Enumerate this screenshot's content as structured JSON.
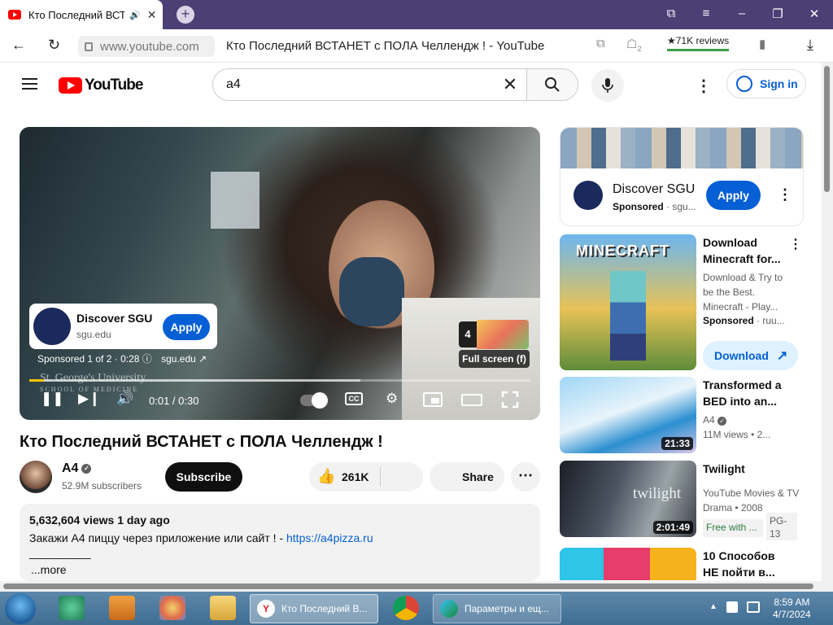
{
  "browser": {
    "tab_title": "Кто Последний ВСТ",
    "new_tab": "+",
    "url": "www.youtube.com",
    "page_title": "Кто Последний ВСТАНЕТ с ПОЛА Челлендж ! - YouTube",
    "reviews": "★71K reviews",
    "tab_badge_count": "2"
  },
  "header": {
    "logo_text": "YouTube",
    "search_query": "a4",
    "sign_in": "Sign in"
  },
  "player": {
    "ad_title": "Discover SGU",
    "ad_domain": "sgu.edu",
    "ad_apply": "Apply",
    "ad_info": "Sponsored 1 of 2 · 0:28",
    "ad_info_domain": "sgu.edu",
    "next_count": "4",
    "full_screen_tip": "Full screen (f)",
    "watermark": "St. George's University",
    "watermark_sub": "SCHOOL OF MEDICINE",
    "time": "0:01 / 0:30",
    "progress_fraction": 0.03,
    "buffered_fraction": 0.66
  },
  "video": {
    "title": "Кто Последний ВСТАНЕТ с ПОЛА Челлендж !",
    "channel": "A4",
    "subscribers": "52.9M subscribers",
    "subscribe": "Subscribe",
    "likes": "261K",
    "share": "Share",
    "views_date": "5,632,604 views  1 day ago",
    "desc_line": "Закажи А4 пиццу через приложение или сайт ! - ",
    "desc_link": "https://a4pizza.ru",
    "desc_sep": "___________",
    "more": "...more"
  },
  "sidebar": {
    "ad": {
      "title": "Discover SGU",
      "sponsored": "Sponsored",
      "domain": " · sgu...",
      "apply": "Apply"
    },
    "recs": [
      {
        "title": "Download Minecraft for...",
        "meta1": "Download & Try to be the Best. Minecraft - Play...",
        "meta2_b": "Sponsored",
        "meta2": " · ruu...",
        "button": "Download",
        "duration": ""
      },
      {
        "title": "Transformed a BED into an...",
        "channel": "A4",
        "meta": "11M views  •  2...",
        "duration": "21:33"
      },
      {
        "title": "Twilight",
        "meta1": "YouTube Movies & TV",
        "meta2": "Drama • 2008",
        "badge": "Free with ...",
        "rating": "PG-13",
        "duration": "2:01:49"
      },
      {
        "title": "10 Способов НЕ пойти в...",
        "duration": ""
      }
    ]
  },
  "taskbar": {
    "task1": "Кто Последний В...",
    "task2": "Параметры и ещ...",
    "time": "8:59 AM",
    "date": "4/7/2024"
  }
}
